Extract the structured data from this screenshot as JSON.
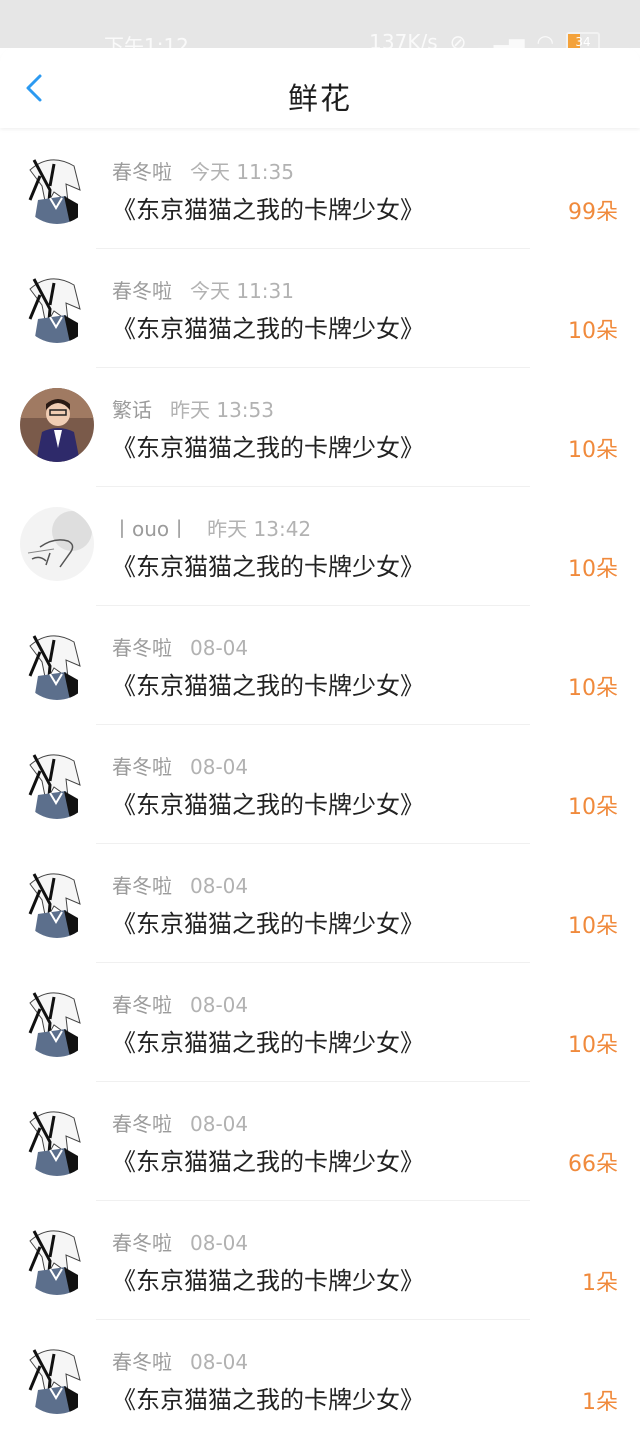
{
  "status_bar": {
    "time": "下午1:12",
    "network_speed": "137K/s",
    "battery_level": "34",
    "icons": [
      "mute-icon",
      "signal-icon",
      "wifi-icon",
      "battery-icon"
    ]
  },
  "header": {
    "title": "鲜花",
    "back_icon": "chevron-left-icon",
    "accent_color": "#2c9af1"
  },
  "amount_color": "#f08a3c",
  "records": [
    {
      "user": "春冬啦",
      "date": "今天 11:35",
      "book": "《东京猫猫之我的卡牌少女》",
      "amount": "99朵",
      "avatar": "anime-avatar"
    },
    {
      "user": "春冬啦",
      "date": "今天 11:31",
      "book": "《东京猫猫之我的卡牌少女》",
      "amount": "10朵",
      "avatar": "anime-avatar"
    },
    {
      "user": "繁话",
      "date": "昨天 13:53",
      "book": "《东京猫猫之我的卡牌少女》",
      "amount": "10朵",
      "avatar": "photo-avatar"
    },
    {
      "user": "丨ouo丨",
      "date": "昨天 13:42",
      "book": "《东京猫猫之我的卡牌少女》",
      "amount": "10朵",
      "avatar": "sketch-avatar"
    },
    {
      "user": "春冬啦",
      "date": "08-04",
      "book": "《东京猫猫之我的卡牌少女》",
      "amount": "10朵",
      "avatar": "anime-avatar"
    },
    {
      "user": "春冬啦",
      "date": "08-04",
      "book": "《东京猫猫之我的卡牌少女》",
      "amount": "10朵",
      "avatar": "anime-avatar"
    },
    {
      "user": "春冬啦",
      "date": "08-04",
      "book": "《东京猫猫之我的卡牌少女》",
      "amount": "10朵",
      "avatar": "anime-avatar"
    },
    {
      "user": "春冬啦",
      "date": "08-04",
      "book": "《东京猫猫之我的卡牌少女》",
      "amount": "10朵",
      "avatar": "anime-avatar"
    },
    {
      "user": "春冬啦",
      "date": "08-04",
      "book": "《东京猫猫之我的卡牌少女》",
      "amount": "66朵",
      "avatar": "anime-avatar"
    },
    {
      "user": "春冬啦",
      "date": "08-04",
      "book": "《东京猫猫之我的卡牌少女》",
      "amount": "1朵",
      "avatar": "anime-avatar"
    },
    {
      "user": "春冬啦",
      "date": "08-04",
      "book": "《东京猫猫之我的卡牌少女》",
      "amount": "1朵",
      "avatar": "anime-avatar"
    }
  ]
}
